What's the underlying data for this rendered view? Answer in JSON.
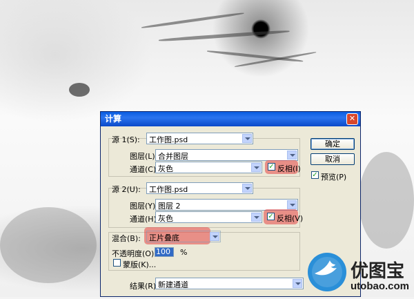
{
  "dialog": {
    "title": "计算",
    "close_glyph": "✕"
  },
  "source1": {
    "label": "源 1(S):",
    "file": "工作图.psd",
    "layer_label": "图层(L):",
    "layer": "合并图层",
    "channel_label": "通道(C):",
    "channel": "灰色",
    "invert_label": "反相(I)",
    "invert_checked": true
  },
  "source2": {
    "label": "源 2(U):",
    "file": "工作图.psd",
    "layer_label": "图层(Y):",
    "layer": "图层 2",
    "channel_label": "通道(H):",
    "channel": "灰色",
    "invert_label": "反相(V)",
    "invert_checked": true
  },
  "blend": {
    "label": "混合(B):",
    "mode": "正片叠底",
    "opacity_label": "不透明度(O):",
    "opacity_value": "100",
    "opacity_unit": "%",
    "mask_label": "蒙版(K)...",
    "mask_checked": false
  },
  "result": {
    "label": "结果(R):",
    "value": "新建通道"
  },
  "buttons": {
    "ok": "确定",
    "cancel": "取消",
    "preview_label": "预览(P)",
    "preview_checked": true
  },
  "watermark": {
    "brand": "优图宝",
    "url": "utobao.com"
  },
  "colors": {
    "title_bar": "#0a5de0",
    "highlight": "#e64646",
    "dialog_bg": "#ece9d8"
  }
}
